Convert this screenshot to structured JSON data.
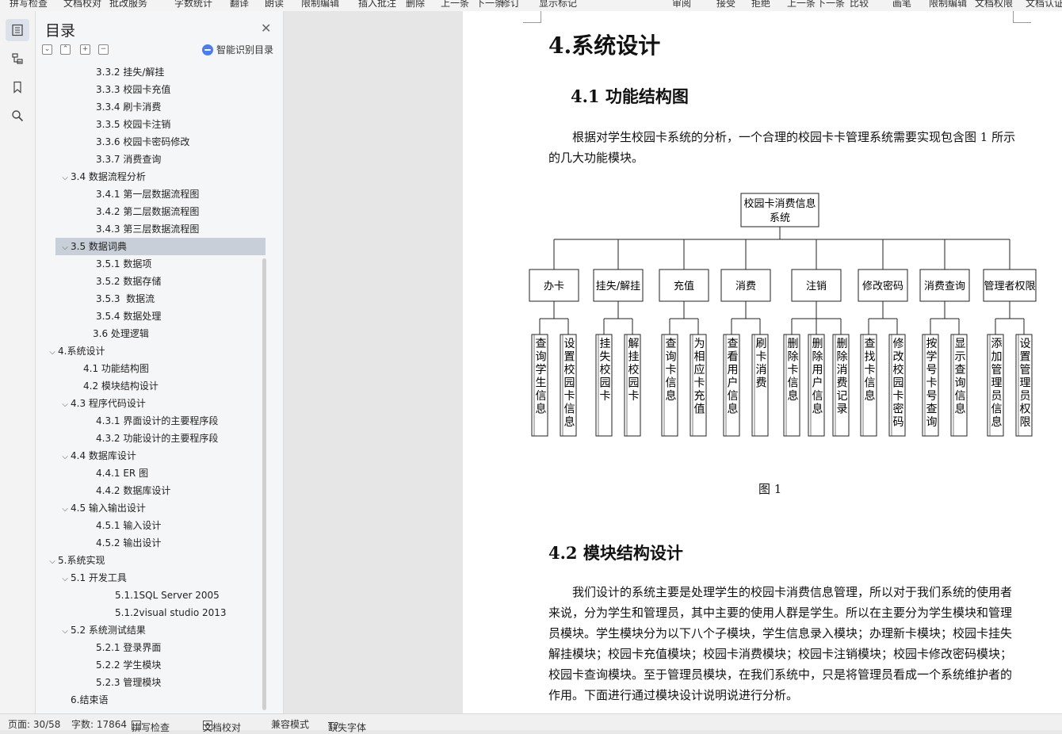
{
  "toolbar": {
    "items": [
      "拼写检查",
      "文档校对",
      "批改服务",
      "字数统计",
      "翻译",
      "朗读",
      "限制编辑",
      "插入批注",
      "删除",
      "上一条",
      "下一条",
      "修订",
      "显示标记",
      "审阅",
      "接受",
      "拒绝",
      "上一条",
      "下一条",
      "比较",
      "画笔",
      "限制编辑",
      "文档权限",
      "文档认证"
    ]
  },
  "rail": {
    "icons": [
      "toc-icon",
      "outline-icon",
      "bookmark-icon",
      "search-icon"
    ]
  },
  "toc": {
    "title": "目录",
    "smart_label": "智能识别目录",
    "selected_index": 10,
    "items": [
      {
        "label": "3.3.2 挂失/解挂",
        "level": 3,
        "chev": ""
      },
      {
        "label": "3.3.3 校园卡充值",
        "level": 3,
        "chev": ""
      },
      {
        "label": "3.3.4 刷卡消费",
        "level": 3,
        "chev": ""
      },
      {
        "label": "3.3.5 校园卡注销",
        "level": 3,
        "chev": ""
      },
      {
        "label": "3.3.6 校园卡密码修改",
        "level": 3,
        "chev": ""
      },
      {
        "label": "3.3.7 消费查询",
        "level": 3,
        "chev": ""
      },
      {
        "label": "3.4 数据流程分析",
        "level": 2,
        "chev": "v"
      },
      {
        "label": "3.4.1 第一层数据流程图",
        "level": 3,
        "chev": ""
      },
      {
        "label": "3.4.2 第二层数据流程图",
        "level": 3,
        "chev": ""
      },
      {
        "label": "3.4.3 第三层数据流程图",
        "level": 3,
        "chev": ""
      },
      {
        "label": "3.5 数据词典",
        "level": 2,
        "chev": "v"
      },
      {
        "label": "3.5.1 数据项",
        "level": 3,
        "chev": ""
      },
      {
        "label": "3.5.2 数据存储",
        "level": 3,
        "chev": ""
      },
      {
        "label": "3.5.3  数据流",
        "level": 3,
        "chev": ""
      },
      {
        "label": "3.5.4 数据处理",
        "level": 3,
        "chev": ""
      },
      {
        "label": "3.6 处理逻辑",
        "level": 2.8,
        "chev": ""
      },
      {
        "label": "4.系统设计",
        "level": 1,
        "chev": "v"
      },
      {
        "label": "4.1 功能结构图",
        "level": 2.5,
        "chev": ""
      },
      {
        "label": "4.2 模块结构设计",
        "level": 2.5,
        "chev": ""
      },
      {
        "label": "4.3 程序代码设计",
        "level": 2,
        "chev": "v"
      },
      {
        "label": "4.3.1 界面设计的主要程序段",
        "level": 3,
        "chev": ""
      },
      {
        "label": "4.3.2 功能设计的主要程序段",
        "level": 3,
        "chev": ""
      },
      {
        "label": "4.4 数据库设计",
        "level": 2,
        "chev": "v"
      },
      {
        "label": "4.4.1 ER 图",
        "level": 3,
        "chev": ""
      },
      {
        "label": "4.4.2 数据库设计",
        "level": 3,
        "chev": ""
      },
      {
        "label": "4.5 输入输出设计",
        "level": 2,
        "chev": "v"
      },
      {
        "label": "4.5.1 输入设计",
        "level": 3,
        "chev": ""
      },
      {
        "label": "4.5.2 输出设计",
        "level": 3,
        "chev": ""
      },
      {
        "label": "5.系统实现",
        "level": 1,
        "chev": "v"
      },
      {
        "label": "5.1 开发工具",
        "level": 2,
        "chev": "v"
      },
      {
        "label": "5.1.1SQL Server 2005",
        "level": 4,
        "chev": ""
      },
      {
        "label": "5.1.2visual studio 2013",
        "level": 4,
        "chev": ""
      },
      {
        "label": "5.2 系统测试结果",
        "level": 2,
        "chev": "v"
      },
      {
        "label": "5.2.1 登录界面",
        "level": 3,
        "chev": ""
      },
      {
        "label": "5.2.2 学生模块",
        "level": 3,
        "chev": ""
      },
      {
        "label": "5.2.3 管理模块",
        "level": 3,
        "chev": ""
      },
      {
        "label": "6.结束语",
        "level": 1.5,
        "chev": ""
      }
    ]
  },
  "doc": {
    "h1": "4.系统设计",
    "h2_1": "4.1 功能结构图",
    "para1": "根据对学生校园卡系统的分析，一个合理的校园卡卡管理系统需要实现包含图 1 所示的几大功能模块。",
    "caption": "图 1",
    "h2_2": "4.2 模块结构设计",
    "para2": "我们设计的系统主要是处理学生的校园卡消费信息管理，所以对于我们系统的使用者来说，分为学生和管理员，其中主要的使用人群是学生。所以在主要分为学生模块和管理员模块。学生模块分为以下八个子模块，学生信息录入模块；办理新卡模块；校园卡挂失解挂模块；校园卡充值模块；校园卡消费模块；校园卡注销模块；校园卡修改密码模块；校园卡查询模块。至于管理员模块，在我们系统中，只是将管理员看成一个系统维护者的作用。下面进行通过模块设计说明说进行分析。"
  },
  "diagram": {
    "root": "校园卡消费信息系统",
    "modules": [
      {
        "name": "办卡",
        "children": [
          "查询学生信息",
          "设置校园卡信息"
        ]
      },
      {
        "name": "挂失/解挂",
        "children": [
          "挂失校园卡",
          "解挂校园卡"
        ]
      },
      {
        "name": "充值",
        "children": [
          "查询卡信息",
          "为相应卡充值"
        ]
      },
      {
        "name": "消费",
        "children": [
          "查看用户信息",
          "刷卡消费"
        ]
      },
      {
        "name": "注销",
        "children": [
          "删除卡信息",
          "删除用户信息",
          "删除消费记录"
        ]
      },
      {
        "name": "修改密码",
        "children": [
          "查找卡信息",
          "修改校园卡密码"
        ]
      },
      {
        "name": "消费查询",
        "children": [
          "按学号卡号查询",
          "显示查询信息"
        ]
      },
      {
        "name": "管理者权限",
        "children": [
          "添加管理员信息",
          "设置管理员权限"
        ]
      }
    ]
  },
  "status": {
    "page": "页面: 30/58",
    "words": "字数: 17864",
    "spell": "拼写检查",
    "proof": "文档校对",
    "compat": "兼容模式",
    "missing_font": "缺失字体"
  },
  "colors": {
    "selected_bg": "#c9cfd8",
    "accent": "#4a7ef0"
  }
}
